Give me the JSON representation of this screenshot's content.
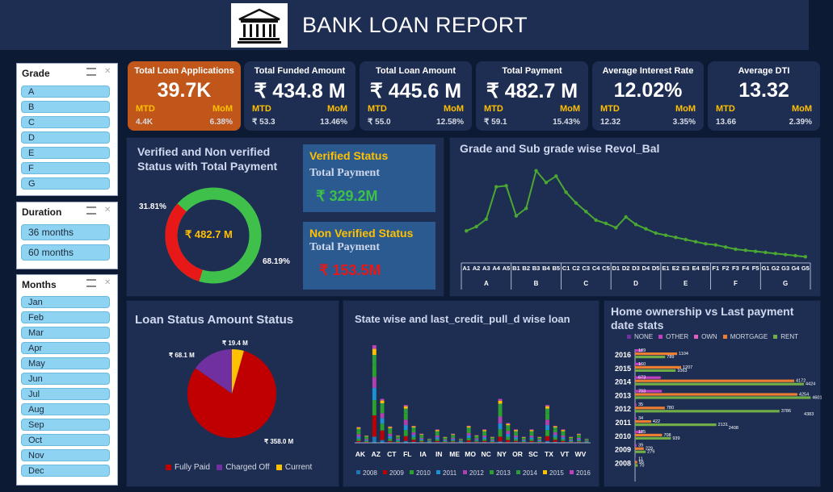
{
  "header": {
    "title": "BANK LOAN REPORT"
  },
  "slicers": {
    "grade": {
      "title": "Grade",
      "items": [
        "A",
        "B",
        "C",
        "D",
        "E",
        "F",
        "G"
      ]
    },
    "duration": {
      "title": "Duration",
      "items": [
        "36 months",
        "60 months"
      ]
    },
    "months": {
      "title": "Months",
      "items": [
        "Jan",
        "Feb",
        "Mar",
        "Apr",
        "May",
        "Jun",
        "Jul",
        "Aug",
        "Sep",
        "Oct",
        "Nov",
        "Dec"
      ]
    }
  },
  "kpis": [
    {
      "title": "Total Loan Applications",
      "value": "39.7K",
      "mtd_label": "MTD",
      "mom_label": "MoM",
      "mtd": "4.4K",
      "mom": "6.38%"
    },
    {
      "title": "Total Funded Amount",
      "value": "₹ 434.8 M",
      "mtd_label": "MTD",
      "mom_label": "MoM",
      "mtd": "₹ 53.3",
      "mom": "13.46%"
    },
    {
      "title": "Total Loan Amount",
      "value": "₹ 445.6 M",
      "mtd_label": "MTD",
      "mom_label": "MoM",
      "mtd": "₹ 55.0",
      "mom": "12.58%"
    },
    {
      "title": "Total Payment",
      "value": "₹ 482.7 M",
      "mtd_label": "MTD",
      "mom_label": "MoM",
      "mtd": "₹ 59.1",
      "mom": "15.43%"
    },
    {
      "title": "Average Interest Rate",
      "value": "12.02%",
      "mtd_label": "MTD",
      "mom_label": "MoM",
      "mtd": "12.32",
      "mom": "3.35%"
    },
    {
      "title": "Average DTI",
      "value": "13.32",
      "mtd_label": "MTD",
      "mom_label": "MoM",
      "mtd": "13.66",
      "mom": "2.39%"
    }
  ],
  "verified": {
    "title": "Verified and Non verified Status with Total Payment",
    "center": "₹ 482.7 M",
    "pct_nonverified": "31.81%",
    "pct_verified": "68.19%",
    "verified_card": {
      "heading": "Verified Status",
      "sub": "Total Payment",
      "value": "₹ 329.2M"
    },
    "nonverified_card": {
      "heading": "Non Verified Status",
      "sub": "Total Payment",
      "value": "₹ 153.5M"
    }
  },
  "revol": {
    "title": "Grade and Sub grade wise Revol_Bal"
  },
  "loan_status": {
    "title": "Loan Status Amount Status",
    "labels": {
      "fully_paid": "₹ 358.0 M",
      "charged_off": "₹ 68.1 M",
      "current": "₹ 19.4 M"
    },
    "legend": [
      "Fully Paid",
      "Charged Off",
      "Current"
    ]
  },
  "state": {
    "title": "State wise and last_credit_pull_d wise loan",
    "states": [
      "AK",
      "AZ",
      "CT",
      "FL",
      "IA",
      "IN",
      "ME",
      "MO",
      "NC",
      "NY",
      "OR",
      "SC",
      "TX",
      "VT",
      "WV"
    ],
    "years": [
      "2008",
      "2009",
      "2010",
      "2011",
      "2012",
      "2013",
      "2014",
      "2015",
      "2016"
    ]
  },
  "home": {
    "title": "Home ownership vs Last payment date stats",
    "legend": [
      "NONE",
      "OTHER",
      "OWN",
      "MORTGAGE",
      "RENT"
    ]
  },
  "colors": {
    "green": "#3db53d",
    "red": "#e81818",
    "navy": "#1e2d52",
    "orange": "#c0561a",
    "gold": "#ffc000"
  },
  "chart_data": [
    {
      "type": "pie",
      "title": "Verified and Non verified Status with Total Payment",
      "categories": [
        "Verified",
        "Non Verified"
      ],
      "values": [
        68.19,
        31.81
      ]
    },
    {
      "type": "line",
      "title": "Grade and Sub grade wise Revol_Bal",
      "groups": [
        "A",
        "B",
        "C",
        "D",
        "E",
        "F",
        "G"
      ],
      "categories": [
        "A1",
        "A2",
        "A3",
        "A4",
        "A5",
        "B1",
        "B2",
        "B3",
        "B4",
        "B5",
        "C1",
        "C2",
        "C3",
        "C4",
        "C5",
        "D1",
        "D2",
        "D3",
        "D4",
        "D5",
        "E1",
        "E2",
        "E3",
        "E4",
        "E5",
        "F1",
        "F2",
        "F3",
        "F4",
        "F5",
        "G1",
        "G2",
        "G3",
        "G4",
        "G5"
      ],
      "values": [
        26,
        30,
        37,
        67,
        68,
        40,
        47,
        82,
        71,
        77,
        62,
        52,
        44,
        36,
        33,
        29,
        39,
        32,
        28,
        24,
        22,
        20,
        18,
        16,
        14,
        13,
        11,
        9,
        8,
        7,
        6,
        5,
        4,
        3,
        2
      ],
      "ylim": [
        0,
        90
      ]
    },
    {
      "type": "pie",
      "title": "Loan Status Amount Status",
      "categories": [
        "Fully Paid",
        "Charged Off",
        "Current"
      ],
      "values": [
        358.0,
        68.1,
        19.4
      ]
    },
    {
      "type": "bar",
      "title": "State wise and last_credit_pull_d wise loan",
      "stacked": true,
      "categories": [
        "AK",
        "AZ",
        "CT",
        "FL",
        "IA",
        "IN",
        "ME",
        "MO",
        "NC",
        "NY",
        "OR",
        "SC",
        "TX",
        "VT",
        "WV"
      ],
      "series": [
        {
          "name": "2008",
          "values": [
            1,
            10,
            1,
            3,
            1,
            1,
            1,
            1,
            1,
            2,
            1,
            1,
            3,
            1,
            1
          ]
        },
        {
          "name": "2009",
          "values": [
            2,
            35,
            2,
            8,
            1,
            2,
            1,
            3,
            2,
            8,
            2,
            2,
            8,
            2,
            1
          ]
        },
        {
          "name": "2010",
          "values": [
            4,
            25,
            4,
            10,
            2,
            3,
            2,
            4,
            3,
            12,
            3,
            3,
            10,
            3,
            2
          ]
        },
        {
          "name": "2011",
          "values": [
            3,
            20,
            4,
            8,
            2,
            3,
            2,
            4,
            3,
            10,
            3,
            3,
            8,
            3,
            2
          ]
        },
        {
          "name": "2012",
          "values": [
            4,
            18,
            4,
            9,
            2,
            3,
            2,
            4,
            3,
            11,
            3,
            3,
            9,
            3,
            2
          ]
        },
        {
          "name": "2013",
          "values": [
            5,
            20,
            5,
            10,
            3,
            4,
            3,
            5,
            4,
            12,
            4,
            4,
            10,
            4,
            3
          ]
        },
        {
          "name": "2014",
          "values": [
            4,
            16,
            4,
            8,
            2,
            3,
            2,
            4,
            3,
            9,
            3,
            3,
            8,
            3,
            2
          ]
        },
        {
          "name": "2015",
          "values": [
            2,
            10,
            2,
            4,
            1,
            2,
            1,
            2,
            2,
            5,
            2,
            2,
            4,
            2,
            1
          ]
        },
        {
          "name": "2016",
          "values": [
            1,
            6,
            1,
            2,
            1,
            1,
            1,
            1,
            1,
            3,
            1,
            1,
            2,
            1,
            1
          ]
        }
      ]
    },
    {
      "type": "bar",
      "orientation": "horizontal",
      "title": "Home ownership vs Last payment date stats",
      "categories": [
        "2016",
        "2015",
        "2014",
        "2013",
        "2012",
        "2011",
        "2010",
        "2009",
        "2008"
      ],
      "series": [
        {
          "name": "NONE",
          "values": [
            0,
            0,
            0,
            0,
            0,
            0,
            0,
            0,
            0
          ]
        },
        {
          "name": "OTHER",
          "values": [
            189,
            160,
            673,
            703,
            35,
            34,
            185,
            39,
            11
          ]
        },
        {
          "name": "OWN",
          "values": [
            0,
            0,
            0,
            0,
            0,
            0,
            0,
            0,
            0
          ]
        },
        {
          "name": "MORTGAGE",
          "values": [
            1104,
            1207,
            4172,
            4254,
            780,
            422,
            708,
            229,
            56
          ]
        },
        {
          "name": "RENT",
          "values": [
            789,
            1063,
            4424,
            4601,
            3786,
            2131,
            939,
            279,
            70
          ]
        }
      ],
      "value_labels": {
        "2016": [
          "189",
          "1104",
          "789"
        ],
        "2015": [
          "160",
          "1207",
          "1063"
        ],
        "2014": [
          "673",
          "4172",
          "4424"
        ],
        "2013": [
          "703",
          "4254",
          "4601"
        ],
        "2012": [
          "35",
          "780",
          "3786",
          "4383"
        ],
        "2011": [
          "34",
          "422",
          "2131",
          "2408"
        ],
        "2010": [
          "185",
          "708",
          "939"
        ],
        "2009": [
          "39",
          "229",
          "279"
        ],
        "2008": [
          "11",
          "56",
          "70"
        ]
      }
    }
  ]
}
